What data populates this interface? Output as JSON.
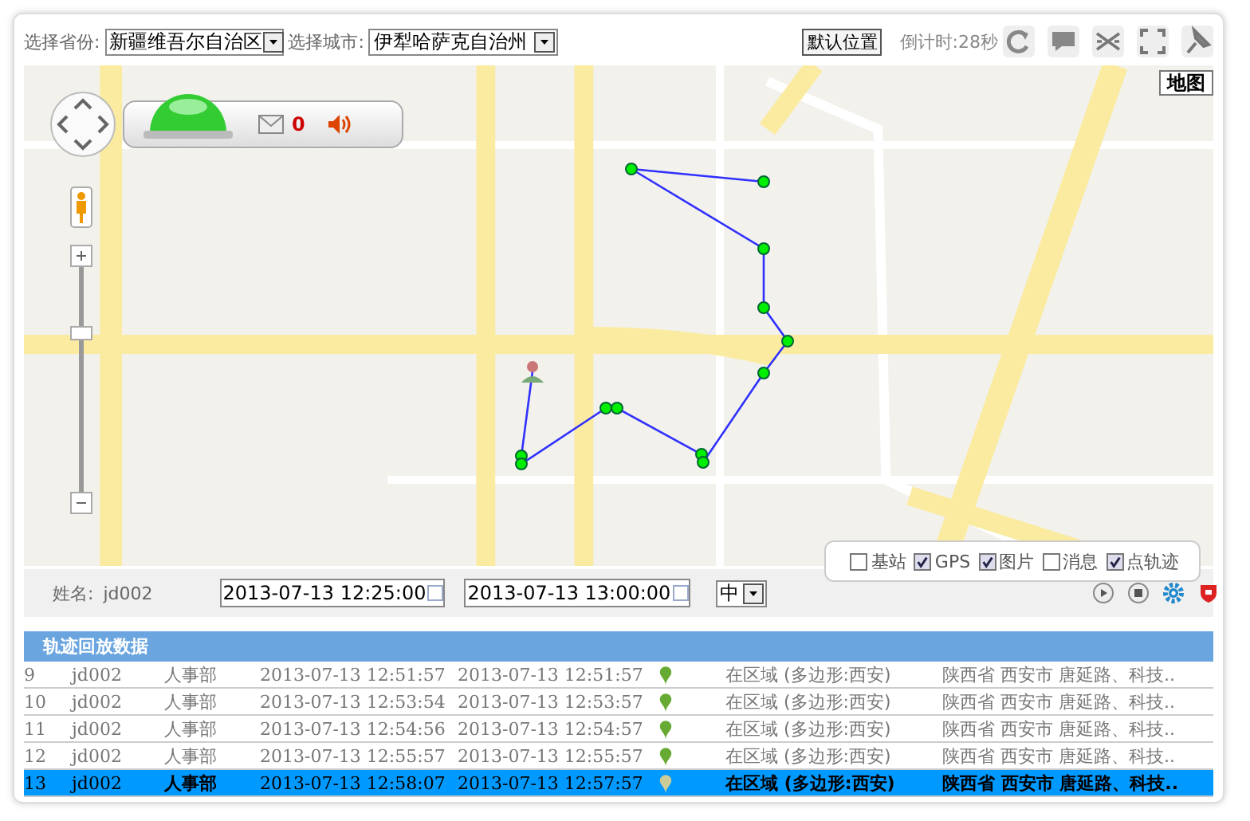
{
  "toolbar": {
    "province_label": "选择省份:",
    "province": "新疆维吾尔自治区",
    "city_label": "选择城市:",
    "city": "伊犁哈萨克自治州",
    "default_button": "默认位置",
    "countdown": "倒计时:28秒"
  },
  "map": {
    "kind": "picture",
    "map_type_button": "地图",
    "unread_count": "0"
  },
  "layers": [
    {
      "label": "基站",
      "checked": false
    },
    {
      "label": "GPS",
      "checked": true
    },
    {
      "label": "图片",
      "checked": true
    },
    {
      "label": "消息",
      "checked": false
    },
    {
      "label": "点轨迹",
      "checked": true
    }
  ],
  "filter": {
    "name_label": "姓名:",
    "name": "jd002",
    "start": "2013-07-13 12:25:00",
    "end": "2013-07-13 13:00:00",
    "speed": "中"
  },
  "table": {
    "title": "轨迹回放数据",
    "rows": [
      {
        "cells": [
          "9",
          "jd002",
          "人事部",
          "2013-07-13 12:51:57",
          "2013-07-13 12:51:57",
          "在区域 (多边形:西安)",
          "陕西省 西安市 唐延路、科技.."
        ],
        "selected": false
      },
      {
        "cells": [
          "10",
          "jd002",
          "人事部",
          "2013-07-13 12:53:54",
          "2013-07-13 12:53:57",
          "在区域 (多边形:西安)",
          "陕西省 西安市 唐延路、科技.."
        ],
        "selected": false
      },
      {
        "cells": [
          "11",
          "jd002",
          "人事部",
          "2013-07-13 12:54:56",
          "2013-07-13 12:54:57",
          "在区域 (多边形:西安)",
          "陕西省 西安市 唐延路、科技.."
        ],
        "selected": false
      },
      {
        "cells": [
          "12",
          "jd002",
          "人事部",
          "2013-07-13 12:55:57",
          "2013-07-13 12:55:57",
          "在区域 (多边形:西安)",
          "陕西省 西安市 唐延路、科技.."
        ],
        "selected": false
      },
      {
        "cells": [
          "13",
          "jd002",
          "人事部",
          "2013-07-13 12:58:07",
          "2013-07-13 12:57:57",
          "在区域 (多边形:西安)",
          "陕西省 西安市 唐延路、科技.."
        ],
        "selected": true
      }
    ]
  }
}
